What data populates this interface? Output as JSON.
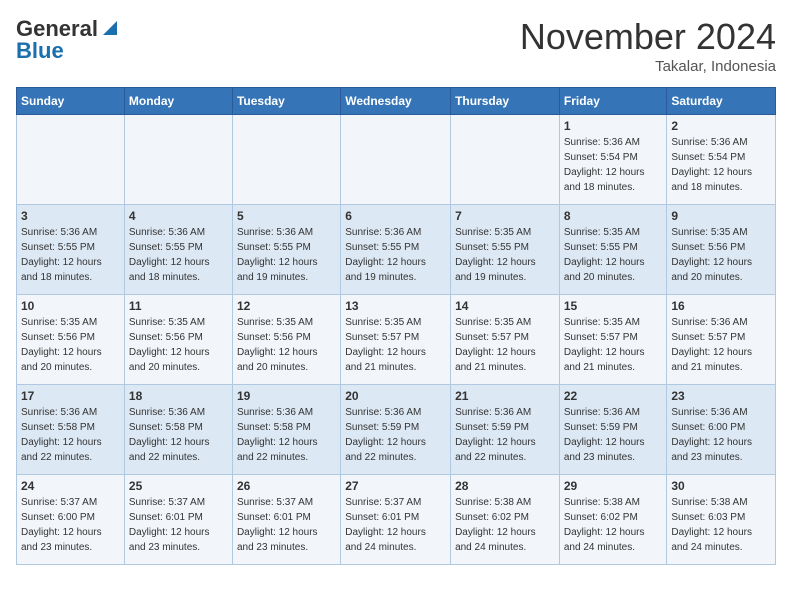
{
  "header": {
    "logo_general": "General",
    "logo_blue": "Blue",
    "month_title": "November 2024",
    "location": "Takalar, Indonesia"
  },
  "days_of_week": [
    "Sunday",
    "Monday",
    "Tuesday",
    "Wednesday",
    "Thursday",
    "Friday",
    "Saturday"
  ],
  "weeks": [
    [
      {
        "day": "",
        "info": ""
      },
      {
        "day": "",
        "info": ""
      },
      {
        "day": "",
        "info": ""
      },
      {
        "day": "",
        "info": ""
      },
      {
        "day": "",
        "info": ""
      },
      {
        "day": "1",
        "info": "Sunrise: 5:36 AM\nSunset: 5:54 PM\nDaylight: 12 hours\nand 18 minutes."
      },
      {
        "day": "2",
        "info": "Sunrise: 5:36 AM\nSunset: 5:54 PM\nDaylight: 12 hours\nand 18 minutes."
      }
    ],
    [
      {
        "day": "3",
        "info": "Sunrise: 5:36 AM\nSunset: 5:55 PM\nDaylight: 12 hours\nand 18 minutes."
      },
      {
        "day": "4",
        "info": "Sunrise: 5:36 AM\nSunset: 5:55 PM\nDaylight: 12 hours\nand 18 minutes."
      },
      {
        "day": "5",
        "info": "Sunrise: 5:36 AM\nSunset: 5:55 PM\nDaylight: 12 hours\nand 19 minutes."
      },
      {
        "day": "6",
        "info": "Sunrise: 5:36 AM\nSunset: 5:55 PM\nDaylight: 12 hours\nand 19 minutes."
      },
      {
        "day": "7",
        "info": "Sunrise: 5:35 AM\nSunset: 5:55 PM\nDaylight: 12 hours\nand 19 minutes."
      },
      {
        "day": "8",
        "info": "Sunrise: 5:35 AM\nSunset: 5:55 PM\nDaylight: 12 hours\nand 20 minutes."
      },
      {
        "day": "9",
        "info": "Sunrise: 5:35 AM\nSunset: 5:56 PM\nDaylight: 12 hours\nand 20 minutes."
      }
    ],
    [
      {
        "day": "10",
        "info": "Sunrise: 5:35 AM\nSunset: 5:56 PM\nDaylight: 12 hours\nand 20 minutes."
      },
      {
        "day": "11",
        "info": "Sunrise: 5:35 AM\nSunset: 5:56 PM\nDaylight: 12 hours\nand 20 minutes."
      },
      {
        "day": "12",
        "info": "Sunrise: 5:35 AM\nSunset: 5:56 PM\nDaylight: 12 hours\nand 20 minutes."
      },
      {
        "day": "13",
        "info": "Sunrise: 5:35 AM\nSunset: 5:57 PM\nDaylight: 12 hours\nand 21 minutes."
      },
      {
        "day": "14",
        "info": "Sunrise: 5:35 AM\nSunset: 5:57 PM\nDaylight: 12 hours\nand 21 minutes."
      },
      {
        "day": "15",
        "info": "Sunrise: 5:35 AM\nSunset: 5:57 PM\nDaylight: 12 hours\nand 21 minutes."
      },
      {
        "day": "16",
        "info": "Sunrise: 5:36 AM\nSunset: 5:57 PM\nDaylight: 12 hours\nand 21 minutes."
      }
    ],
    [
      {
        "day": "17",
        "info": "Sunrise: 5:36 AM\nSunset: 5:58 PM\nDaylight: 12 hours\nand 22 minutes."
      },
      {
        "day": "18",
        "info": "Sunrise: 5:36 AM\nSunset: 5:58 PM\nDaylight: 12 hours\nand 22 minutes."
      },
      {
        "day": "19",
        "info": "Sunrise: 5:36 AM\nSunset: 5:58 PM\nDaylight: 12 hours\nand 22 minutes."
      },
      {
        "day": "20",
        "info": "Sunrise: 5:36 AM\nSunset: 5:59 PM\nDaylight: 12 hours\nand 22 minutes."
      },
      {
        "day": "21",
        "info": "Sunrise: 5:36 AM\nSunset: 5:59 PM\nDaylight: 12 hours\nand 22 minutes."
      },
      {
        "day": "22",
        "info": "Sunrise: 5:36 AM\nSunset: 5:59 PM\nDaylight: 12 hours\nand 23 minutes."
      },
      {
        "day": "23",
        "info": "Sunrise: 5:36 AM\nSunset: 6:00 PM\nDaylight: 12 hours\nand 23 minutes."
      }
    ],
    [
      {
        "day": "24",
        "info": "Sunrise: 5:37 AM\nSunset: 6:00 PM\nDaylight: 12 hours\nand 23 minutes."
      },
      {
        "day": "25",
        "info": "Sunrise: 5:37 AM\nSunset: 6:01 PM\nDaylight: 12 hours\nand 23 minutes."
      },
      {
        "day": "26",
        "info": "Sunrise: 5:37 AM\nSunset: 6:01 PM\nDaylight: 12 hours\nand 23 minutes."
      },
      {
        "day": "27",
        "info": "Sunrise: 5:37 AM\nSunset: 6:01 PM\nDaylight: 12 hours\nand 24 minutes."
      },
      {
        "day": "28",
        "info": "Sunrise: 5:38 AM\nSunset: 6:02 PM\nDaylight: 12 hours\nand 24 minutes."
      },
      {
        "day": "29",
        "info": "Sunrise: 5:38 AM\nSunset: 6:02 PM\nDaylight: 12 hours\nand 24 minutes."
      },
      {
        "day": "30",
        "info": "Sunrise: 5:38 AM\nSunset: 6:03 PM\nDaylight: 12 hours\nand 24 minutes."
      }
    ]
  ]
}
